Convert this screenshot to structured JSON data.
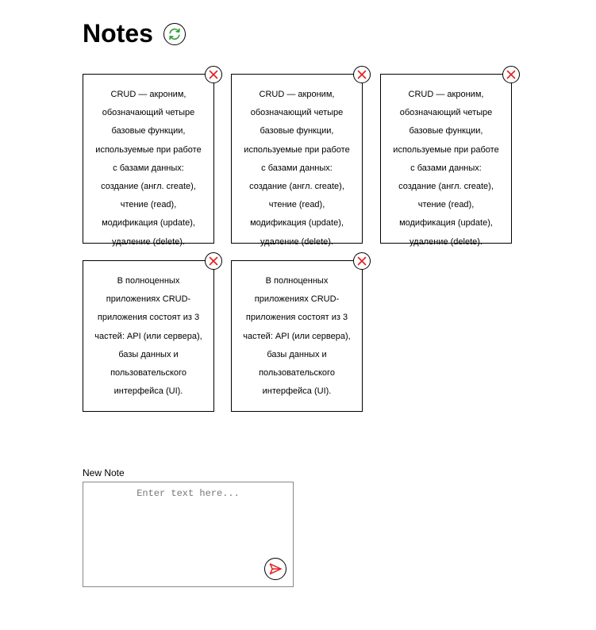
{
  "header": {
    "title": "Notes",
    "refresh_icon": "refresh-icon"
  },
  "colors": {
    "refresh": "#2e9c2e",
    "delete": "#e02020",
    "send": "#e02020",
    "border": "#000000"
  },
  "notes": [
    {
      "text": "CRUD — акроним, обозначающий четыре базовые функции, используемые при работе с базами данных: создание (англ. create), чтение (read), модификация (update), удаление (delete)."
    },
    {
      "text": "CRUD — акроним, обозначающий четыре базовые функции, используемые при работе с базами данных: создание (англ. create), чтение (read), модификация (update), удаление (delete)."
    },
    {
      "text": "CRUD — акроним, обозначающий четыре базовые функции, используемые при работе с базами данных: создание (англ. create), чтение (read), модификация (update), удаление (delete)."
    },
    {
      "text": "В полноценных приложениях CRUD-приложения состоят из 3 частей: API (или сервера), базы данных и пользовательского интерфейса (UI)."
    },
    {
      "text": "В полноценных приложениях CRUD-приложения состоят из 3 частей: API (или сервера), базы данных и пользовательского интерфейса (UI)."
    }
  ],
  "new_note": {
    "label": "New Note",
    "placeholder": "Enter text here...",
    "value": ""
  }
}
